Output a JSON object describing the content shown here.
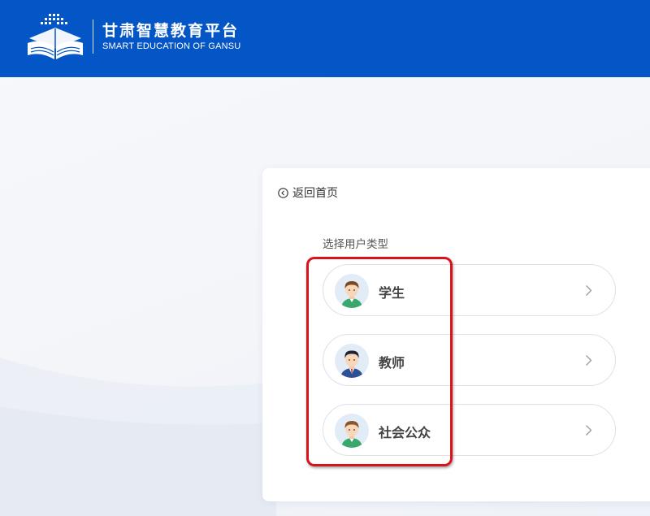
{
  "header": {
    "title": "甘肃智慧教育平台",
    "subtitle": "SMART EDUCATION OF GANSU",
    "logo_icon": "open-book-logo-icon",
    "background_color": "#0455c6"
  },
  "card": {
    "back_label": "返回首页",
    "back_icon": "circle-chevron-left-icon",
    "section_label": "选择用户类型",
    "options": [
      {
        "label": "学生",
        "avatar": "student-avatar-icon"
      },
      {
        "label": "教师",
        "avatar": "teacher-avatar-icon"
      },
      {
        "label": "社会公众",
        "avatar": "public-avatar-icon"
      }
    ],
    "option_icon": "chevron-right-icon"
  },
  "annotation": {
    "highlight_color": "#d9131c"
  }
}
